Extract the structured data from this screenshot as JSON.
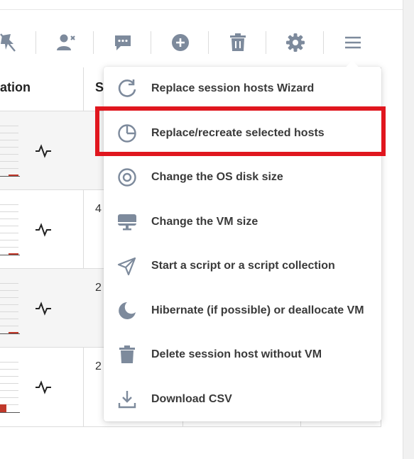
{
  "table": {
    "header": {
      "col1": "ation",
      "col2": "S"
    },
    "rows": [
      {
        "value": "",
        "bar_level": 0.02
      },
      {
        "value": "4",
        "bar_level": 0.02
      },
      {
        "value": "2",
        "bar_level": 0.02
      },
      {
        "value": "2",
        "bar_level": 0.15
      }
    ]
  },
  "toolbar": {
    "icons": [
      "pin-off-icon",
      "user-remove-icon",
      "message-icon",
      "add-circle-icon",
      "trash-icon",
      "gear-icon",
      "hamburger-menu-icon"
    ]
  },
  "menu": {
    "items": [
      {
        "label": "Replace session hosts Wizard",
        "icon": "refresh-icon"
      },
      {
        "label": "Replace/recreate selected hosts",
        "icon": "pie-chart-icon",
        "highlighted": true
      },
      {
        "label": "Change the OS disk size",
        "icon": "disk-icon"
      },
      {
        "label": "Change the VM size",
        "icon": "monitor-icon"
      },
      {
        "label": "Start a script or a script collection",
        "icon": "send-icon"
      },
      {
        "label": "Hibernate (if possible) or deallocate VM",
        "icon": "moon-icon"
      },
      {
        "label": "Delete session host without VM",
        "icon": "trash-icon"
      },
      {
        "label": "Download CSV",
        "icon": "download-icon"
      }
    ]
  },
  "colors": {
    "icon": "#7d8a9c",
    "highlight": "#e0161e",
    "bar": "#c0392b"
  }
}
